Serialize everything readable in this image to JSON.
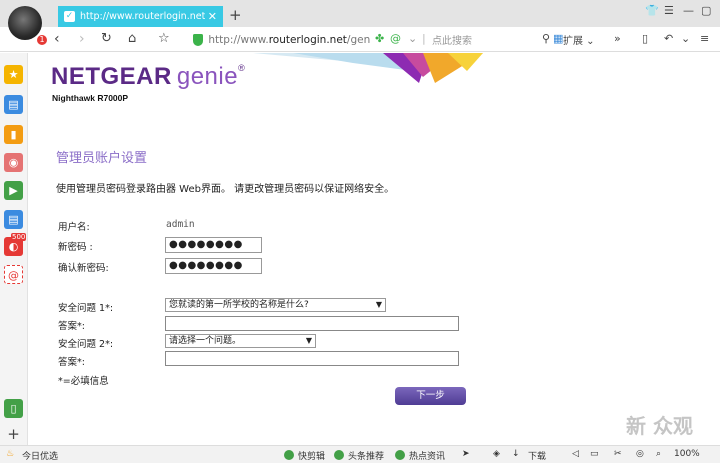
{
  "browser": {
    "tab_title": "http://www.routerlogin.net/ge",
    "new_tab_symbol": "+",
    "url_prefix": "http://www.",
    "url_domain": "routerlogin.net",
    "url_suffix": "/genie",
    "search_placeholder": "点此搜索",
    "extensions_label": "扩展",
    "notification_count": "1"
  },
  "sidebar": {
    "badge_count": "500"
  },
  "page": {
    "brand": "NETGEAR",
    "brand_sub": "genie",
    "model": "Nighthawk R7000P",
    "section_title": "管理员账户设置",
    "description": "使用管理员密码登录路由器 Web界面。 请更改管理员密码以保证网络安全。",
    "username_label": "用户名:",
    "username_value": "admin",
    "new_password_label": "新密码 :",
    "new_password_value": "●●●●●●●●",
    "confirm_password_label": "确认新密码:",
    "confirm_password_value": "●●●●●●●●",
    "security_q1_label": "安全问题 1*:",
    "security_q1_value": "您就读的第一所学校的名称是什么?",
    "answer1_label": "答案*:",
    "security_q2_label": "安全问题 2*:",
    "security_q2_value": "请选择一个问题。",
    "answer2_label": "答案*:",
    "required_note": "*=必填信息",
    "next_button": "下一步"
  },
  "statusbar": {
    "left_label": "今日优选",
    "items": [
      "快剪辑",
      "头条推荐",
      "热点资讯",
      "下载"
    ],
    "zoom": "100%"
  },
  "watermark": "新 众观",
  "colors": {
    "tab_accent": "#38c9e4",
    "brand_purple": "#5b2a86",
    "title_purple": "#8b6ec8",
    "button_purple": "#5e4aa3"
  }
}
